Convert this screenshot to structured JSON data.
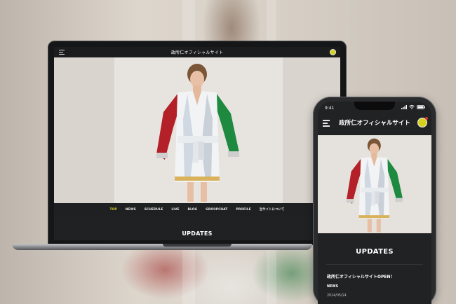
{
  "site": {
    "title": "政所仁オフィシャルサイト"
  },
  "laptop": {
    "nav": [
      {
        "label": "TOP",
        "active": true
      },
      {
        "label": "NEWS",
        "active": false
      },
      {
        "label": "SCHEDULE",
        "active": false
      },
      {
        "label": "LIVE",
        "active": false
      },
      {
        "label": "BLOG",
        "active": false
      },
      {
        "label": "GROUPCHAT",
        "active": false
      },
      {
        "label": "PROFILE",
        "active": false
      },
      {
        "label": "当サイトについて",
        "active": false
      }
    ],
    "section_heading": "UPDATES"
  },
  "phone": {
    "status_time": "9:41",
    "section_heading": "UPDATES",
    "news": {
      "title": "政所仁オフィシャルサイトOPEN！",
      "category": "NEWS",
      "date": "2024/05/14"
    }
  },
  "icons": {
    "menu": "hamburger-menu-icon",
    "avatar": "user-avatar-icon",
    "signal": "signal-icon",
    "wifi": "wifi-icon",
    "battery": "battery-icon"
  },
  "colors": {
    "accent": "#d7cf2a",
    "screen_bg": "#202122",
    "robe_red": "#b32028",
    "robe_green": "#1d8a3f"
  }
}
